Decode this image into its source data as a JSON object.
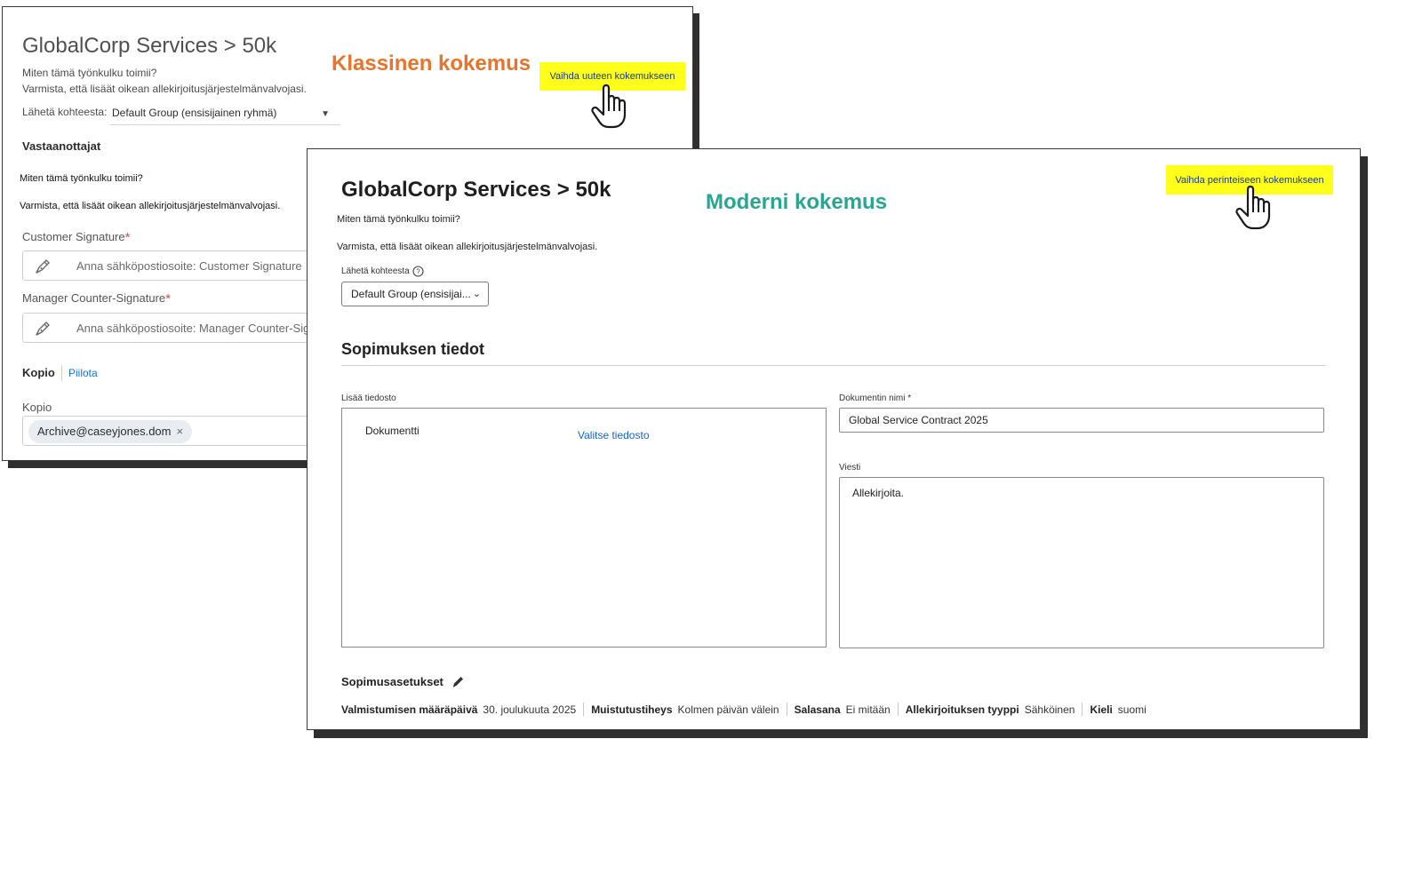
{
  "classic": {
    "title": "GlobalCorp Services > 50k",
    "how_it_works": "Miten tämä työnkulku toimii?",
    "ensure_admin": "Varmista, että lisäät oikean allekirjoitusjärjestelmänvalvojasi.",
    "send_from_label": "Lähetä kohteesta:",
    "send_from_value": "Default Group (ensisijainen ryhmä)",
    "recipients_heading": "Vastaanottajat",
    "overlay_how_it_works": "Miten tämä työnkulku toimii?",
    "overlay_ensure_admin": "Varmista, että lisäät oikean allekirjoitusjärjestelmänvalvojasi.",
    "customer_signature_label": "Customer Signature",
    "customer_signature_placeholder": "Anna sähköpostiosoite: Customer Signature",
    "manager_signature_label": "Manager Counter-Signature",
    "manager_signature_placeholder": "Anna sähköpostiosoite: Manager Counter-Signature",
    "required_mark": "*",
    "cc_tab": "Kopio",
    "hide_link": "Piilota",
    "cc_label": "Kopio",
    "cc_chip": "Archive@caseyjones.dom",
    "chip_remove": "×",
    "experience_heading": "Klassinen kokemus",
    "switch_button": "Vaihda uuteen kokemukseen"
  },
  "modern": {
    "title": "GlobalCorp Services > 50k",
    "how_it_works": "Miten tämä työnkulku toimii?",
    "ensure_admin": "Varmista, että lisäät oikean allekirjoitusjärjestelmänvalvojasi.",
    "experience_heading": "Moderni kokemus",
    "switch_button": "Vaihda perinteiseen kokemukseen",
    "send_from_label": "Lähetä kohteesta",
    "send_from_value": "Default Group (ensisijai...",
    "section_title": "Sopimuksen tiedot",
    "add_file_label": "Lisää tiedosto",
    "document_label": "Dokumentti",
    "choose_file": "Valitse tiedosto",
    "doc_name_label": "Dokumentin nimi",
    "doc_name_required": "*",
    "doc_name_value": "Global Service Contract 2025",
    "message_label": "Viesti",
    "message_value": "Allekirjoita.",
    "settings_title": "Sopimusasetukset",
    "settings": [
      {
        "key": "Valmistumisen määräpäivä",
        "value": "30. joulukuuta 2025"
      },
      {
        "key": "Muistutustiheys",
        "value": "Kolmen päivän välein"
      },
      {
        "key": "Salasana",
        "value": "Ei mitään"
      },
      {
        "key": "Allekirjoituksen tyyppi",
        "value": "Sähköinen"
      },
      {
        "key": "Kieli",
        "value": "suomi"
      }
    ]
  },
  "icons": {
    "pen": "pen-icon",
    "hand_cursor": "hand-pointer-icon",
    "help": "help-circle-icon",
    "edit": "pencil-icon",
    "chevron": "chevron-down-icon"
  },
  "colors": {
    "highlight": "#ffff1a",
    "classic_heading": "#e8732a",
    "modern_heading": "#2aa58f",
    "link": "#1473e6",
    "required": "#e34850"
  }
}
